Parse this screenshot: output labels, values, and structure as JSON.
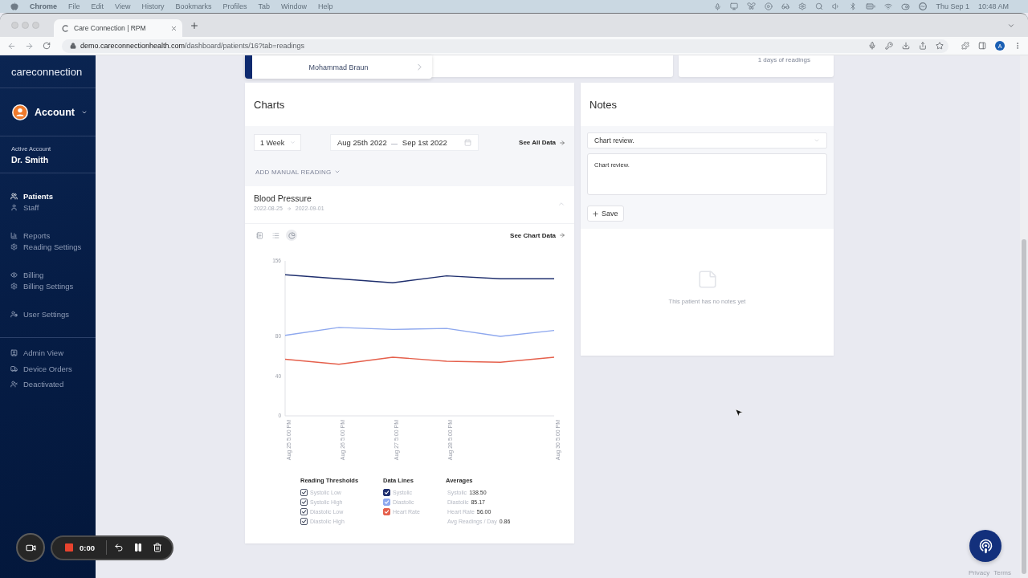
{
  "menu_bar": {
    "app_name": "Chrome",
    "menus": [
      "File",
      "Edit",
      "View",
      "History",
      "Bookmarks",
      "Profiles",
      "Tab",
      "Window",
      "Help"
    ],
    "date": "Thu Sep 1",
    "time": "10:48 AM"
  },
  "browser": {
    "tabs": [
      {
        "title": "Care Connection | RPM",
        "selected": true
      }
    ],
    "url_host": "demo.careconnectionhealth.com",
    "url_path": "/dashboard/patients/16?tab=readings",
    "profile_initial": "A"
  },
  "sidebar": {
    "logo": "careconnection",
    "account": "Account",
    "active_account_label": "Active Account",
    "active_account_name": "Dr. Smith",
    "nav_groups": [
      {
        "items": [
          {
            "label": "Patients",
            "selected": true
          },
          {
            "label": "Staff",
            "selected": false
          }
        ]
      },
      {
        "items": [
          {
            "label": "Reports",
            "selected": false
          },
          {
            "label": "Reading Settings",
            "selected": false
          }
        ]
      },
      {
        "items": [
          {
            "label": "Billing",
            "selected": false
          },
          {
            "label": "Billing Settings",
            "selected": false
          }
        ]
      },
      {
        "items": [
          {
            "label": "User Settings",
            "selected": false
          }
        ]
      }
    ],
    "admin_items": [
      {
        "label": "Admin View",
        "selected": false
      },
      {
        "label": "Device Orders",
        "selected": false
      },
      {
        "label": "Deactivated",
        "selected": false
      }
    ]
  },
  "patient_bar": {
    "patient_name": "Mohammad Braun",
    "readings_summary": "1 days of readings"
  },
  "charts": {
    "title": "Charts",
    "range": "1 Week",
    "date_from": "Aug 25th 2022",
    "date_to": "Sep 1st 2022",
    "see_all": "See All Data",
    "add_reading": "ADD MANUAL READING",
    "section": {
      "title": "Blood Pressure",
      "date_from": "2022-08-25",
      "date_to": "2022-09-01",
      "expanded": true,
      "view_modes": [
        {
          "selected": false
        },
        {
          "selected": false
        },
        {
          "selected": true
        }
      ],
      "see_chart_data": "See Chart Data",
      "chart_data": {
        "type": "line",
        "categories": [
          "Aug 25 5:00 PM",
          "Aug 26 5:00 PM",
          "Aug 27 5:00 PM",
          "Aug 28 5:00 PM",
          null,
          "Aug 30 5:00 PM"
        ],
        "ylim": [
          0,
          156
        ],
        "yticks": [
          0,
          40,
          80,
          156
        ],
        "series": [
          {
            "name": "Systolic",
            "color": "#1f2f6e",
            "values": [
              142,
              138,
              134,
              141,
              138,
              138
            ]
          },
          {
            "name": "Diastolic",
            "color": "#8ea8ee",
            "values": [
              81,
              89,
              87,
              88,
              80,
              86
            ]
          },
          {
            "name": "Heart Rate",
            "color": "#e5604c",
            "values": [
              57,
              52,
              59,
              55,
              54,
              59
            ]
          }
        ]
      },
      "legend": {
        "thresholds": {
          "title": "Reading Thresholds",
          "items": [
            {
              "label": "Systolic Low",
              "checked": true
            },
            {
              "label": "Systolic High",
              "checked": true
            },
            {
              "label": "Diastolic Low",
              "checked": true
            },
            {
              "label": "Diastolic High",
              "checked": true
            }
          ]
        },
        "data_lines": {
          "title": "Data Lines",
          "items": [
            {
              "checked": true
            },
            {
              "checked": true
            },
            {
              "checked": true
            }
          ]
        },
        "averages": {
          "title": "Averages",
          "items": [
            {
              "label": "Systolic",
              "value": "138.50"
            },
            {
              "label": "Diastolic",
              "value": "85.17"
            },
            {
              "label": "Heart Rate",
              "value": "56.00"
            },
            {
              "label": "Avg Readings / Day",
              "value": "0.86"
            }
          ]
        }
      }
    }
  },
  "notes": {
    "title": "Notes",
    "template": "Chart review.",
    "text": "Chart review.",
    "save": "Save",
    "empty_message": "This patient has no notes yet"
  },
  "recorder": {
    "timer": "0:00"
  },
  "footer_links": [
    "Privacy",
    "Terms"
  ]
}
